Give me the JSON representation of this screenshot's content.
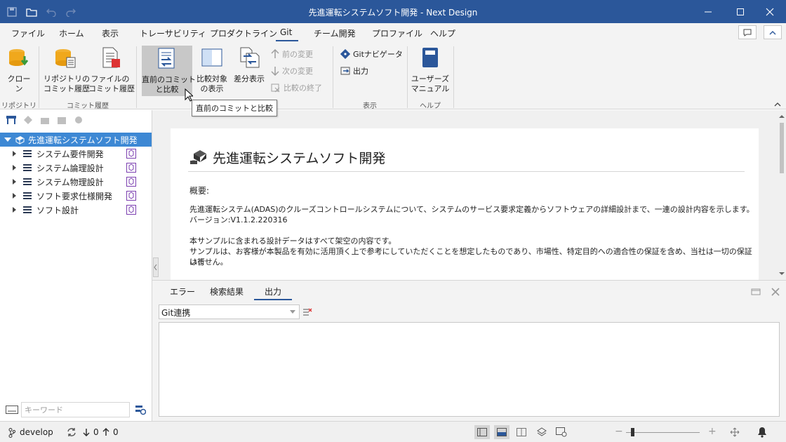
{
  "window": {
    "title": "先進運転システムソフト開発 - Next Design"
  },
  "menu_tabs": [
    "ファイル",
    "ホーム",
    "表示",
    "トレーサビリティ",
    "プロダクトライン",
    "Git",
    "チーム開発",
    "プロファイル",
    "ヘルプ"
  ],
  "active_tab": "Git",
  "ribbon": {
    "clone": "クローン",
    "repo_history": "リポジトリの\nコミット履歴",
    "file_history": "ファイルの\nコミット履歴",
    "compare_prev": "直前のコミット\nと比較",
    "show_compare": "比較対象\nの表示",
    "diff_view": "差分表示",
    "prev_change": "前の変更",
    "next_change": "次の変更",
    "end_compare": "比較の終了",
    "git_navigator": "Gitナビゲータ",
    "output": "出力",
    "user_manual": "ユーザーズ\nマニュアル",
    "groups": {
      "repository": "リポジトリ",
      "commit_history": "コミット履歴",
      "view": "表示",
      "help": "ヘルプ"
    }
  },
  "tooltip": "直前のコミットと比較",
  "tree": {
    "root": "先進運転システムソフト開発",
    "items": [
      "システム要件開発",
      "システム論理設計",
      "システム物理設計",
      "ソフト要求仕様開発",
      "ソフト設計"
    ]
  },
  "left_search": {
    "placeholder": "キーワード"
  },
  "document": {
    "title": "先進運転システムソフト開発",
    "overview_label": "概要:",
    "line1": "先進運転システム(ADAS)のクルーズコントロールシステムについて、システムのサービス要求定義からソフトウェアの詳細設計まで、一連の設計内容を示します。",
    "line2": "バージョン:V1.1.2.220316",
    "line3": "本サンプルに含まれる設計データはすべて架空の内容です。",
    "line4": "サンプルは、お客様が本製品を有効に活用頂く上で参考にしていただくことを想定したものであり、市場性、特定目的への適合性の保証を含め、当社は一切の保証は行",
    "line5": "いません。"
  },
  "bottom_tabs": [
    "エラー",
    "検索結果",
    "出力"
  ],
  "bottom_active": "出力",
  "output_combo": "Git連携",
  "status": {
    "branch": "develop",
    "down": "0",
    "up": "0"
  },
  "colors": {
    "accent": "#2b579a",
    "selection": "#3d88d4"
  }
}
